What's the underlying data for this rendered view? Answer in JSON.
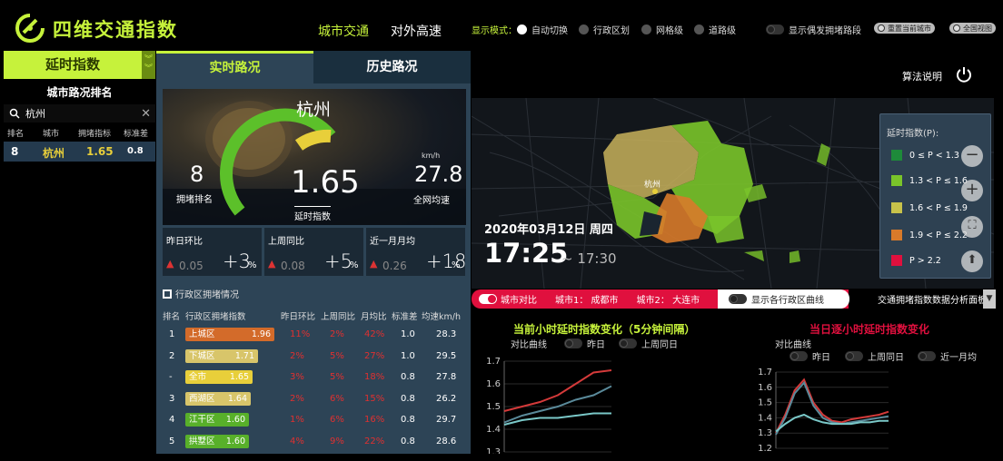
{
  "header": {
    "title": "四维交通指数",
    "nav": [
      "城市交通",
      "对外高速"
    ],
    "mode_label": "显示模式：",
    "modes": [
      "自动切换",
      "行政区划",
      "网格级",
      "道路级"
    ],
    "show_sudden": "显示偶发拥堵路段",
    "reset_city": "重置当前城市",
    "fullscreen": "全国视图",
    "algo": "算法说明"
  },
  "left": {
    "tab": "延时指数",
    "title": "城市路况排名",
    "search": "杭州",
    "cols": [
      "排名",
      "城市",
      "拥堵指标",
      "标准差"
    ],
    "rows": [
      {
        "rank": "8",
        "city": "杭州",
        "index": "1.65",
        "sd": "0.8"
      }
    ]
  },
  "tabs": [
    "实时路况",
    "历史路况"
  ],
  "hero": {
    "city": "杭州",
    "rank": "8",
    "rank_label": "拥堵排名",
    "index": "1.65",
    "index_label": "延时指数",
    "speed": "27.8",
    "speed_unit": "km/h",
    "speed_label": "全网均速"
  },
  "cards": [
    {
      "label": "昨日环比",
      "small": "0.05",
      "big": "+3",
      "pct": "%"
    },
    {
      "label": "上周同比",
      "small": "0.08",
      "big": "+5",
      "pct": "%"
    },
    {
      "label": "近一月月均",
      "small": "0.26",
      "big": "+18",
      "pct": "%"
    }
  ],
  "district": {
    "title": "行政区拥堵情况",
    "cols": [
      "排名",
      "行政区拥堵指数",
      "昨日环比",
      "上周同比",
      "月均比",
      "标准差",
      "均速km/h"
    ],
    "rows": [
      {
        "rank": "1",
        "name": "上城区",
        "value": "1.96",
        "d": "11%",
        "w": "2%",
        "m": "42%",
        "sd": "1.0",
        "speed": "28.3",
        "color": "#d36b2a",
        "fill": 0.98
      },
      {
        "rank": "2",
        "name": "下城区",
        "value": "1.71",
        "d": "2%",
        "w": "5%",
        "m": "27%",
        "sd": "1.0",
        "speed": "29.5",
        "color": "#d8c56a",
        "fill": 0.8
      },
      {
        "rank": "-",
        "name": "全市",
        "value": "1.65",
        "d": "3%",
        "w": "5%",
        "m": "18%",
        "sd": "0.8",
        "speed": "27.8",
        "color": "#e8cf3a",
        "fill": 0.74
      },
      {
        "rank": "3",
        "name": "西湖区",
        "value": "1.64",
        "d": "2%",
        "w": "6%",
        "m": "15%",
        "sd": "0.8",
        "speed": "26.2",
        "color": "#d8c56a",
        "fill": 0.72
      },
      {
        "rank": "4",
        "name": "江干区",
        "value": "1.60",
        "d": "1%",
        "w": "6%",
        "m": "16%",
        "sd": "0.8",
        "speed": "29.7",
        "color": "#58b02a",
        "fill": 0.7
      },
      {
        "rank": "5",
        "name": "拱墅区",
        "value": "1.60",
        "d": "4%",
        "w": "9%",
        "m": "22%",
        "sd": "0.8",
        "speed": "28.6",
        "color": "#58b02a",
        "fill": 0.7
      }
    ]
  },
  "map": {
    "legend_title": "延时指数(P):",
    "legend": [
      {
        "label": "0 ≤ P < 1.3",
        "color": "#1e8a3a"
      },
      {
        "label": "1.3 < P ≤ 1.6",
        "color": "#7ac42a"
      },
      {
        "label": "1.6 < P ≤ 1.9",
        "color": "#c8c24a"
      },
      {
        "label": "1.9 < P ≤ 2.2",
        "color": "#d87a2a"
      },
      {
        "label": "P > 2.2",
        "color": "#e0103e"
      }
    ],
    "date": "2020年03月12日  周四",
    "time": "17:25",
    "time_end": "~ 17:30",
    "city_label": "杭州"
  },
  "compare": {
    "toggle": "城市对比",
    "city1": "城市1：  成都市",
    "city2": "城市2：  大连市",
    "show_district": "显示各行政区曲线",
    "analysis": "交通拥堵指数数据分析面板"
  },
  "chart_data": [
    {
      "type": "line",
      "title": "当前小时延时指数变化（5分钟间隔）",
      "compare_label": "对比曲线",
      "toggles": [
        "昨日",
        "上周同日"
      ],
      "ylim": [
        1.3,
        1.7
      ],
      "yticks": [
        "1.7",
        "1.6",
        "1.5",
        "1.4",
        "1.3"
      ],
      "series": [
        {
          "color": "#d43a3a",
          "values": [
            1.48,
            1.5,
            1.52,
            1.55,
            1.6,
            1.65,
            1.66
          ]
        },
        {
          "color": "#5a8a9a",
          "values": [
            1.43,
            1.46,
            1.48,
            1.5,
            1.53,
            1.55,
            1.59
          ]
        },
        {
          "color": "#7ac8c8",
          "values": [
            1.42,
            1.44,
            1.45,
            1.45,
            1.46,
            1.47,
            1.47
          ]
        }
      ]
    },
    {
      "type": "line",
      "title": "当日逐小时延时指数变化",
      "compare_label": "对比曲线",
      "toggles": [
        "昨日",
        "上周同日",
        "近一月均"
      ],
      "ylim": [
        1.2,
        1.7
      ],
      "yticks": [
        "1.7",
        "1.6",
        "1.5",
        "1.4",
        "1.3",
        "1.2"
      ],
      "series": [
        {
          "color": "#d43a3a",
          "values": [
            1.3,
            1.42,
            1.58,
            1.65,
            1.5,
            1.42,
            1.38,
            1.37,
            1.39,
            1.4,
            1.41,
            1.42,
            1.44
          ]
        },
        {
          "color": "#5a8a9a",
          "values": [
            1.29,
            1.4,
            1.56,
            1.63,
            1.48,
            1.4,
            1.37,
            1.36,
            1.37,
            1.38,
            1.39,
            1.4,
            1.41
          ]
        },
        {
          "color": "#7ac8c8",
          "values": [
            1.31,
            1.36,
            1.4,
            1.42,
            1.39,
            1.37,
            1.36,
            1.36,
            1.36,
            1.37,
            1.37,
            1.38,
            1.38
          ]
        }
      ]
    }
  ]
}
